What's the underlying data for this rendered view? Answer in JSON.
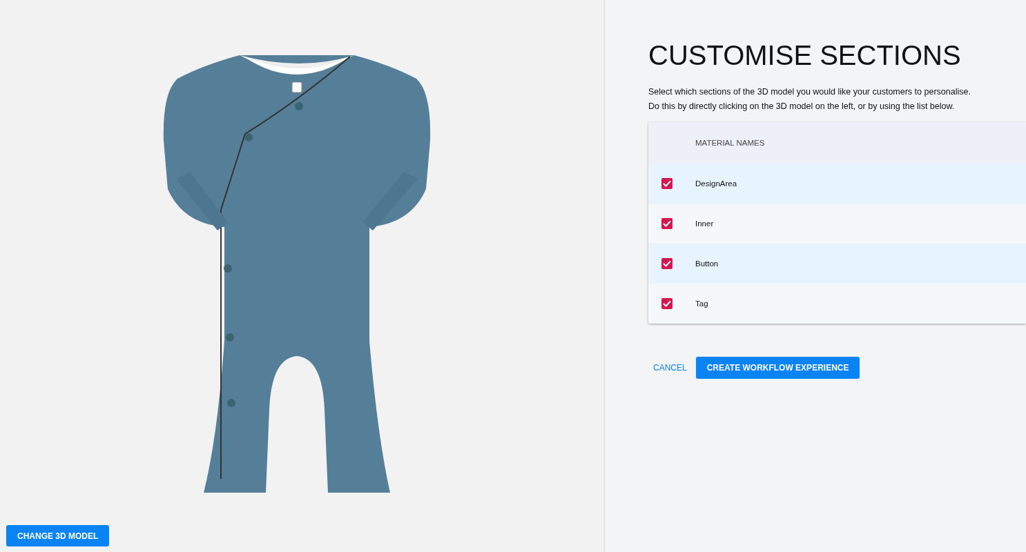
{
  "viewer": {
    "change_button": "CHANGE 3D MODEL"
  },
  "panel": {
    "title": "CUSTOMISE SECTIONS",
    "description": [
      "Select which sections of the 3D model you would like your customers to personalise.",
      "Do this by directly clicking on the 3D model on the left, or by using the list below."
    ],
    "table": {
      "columns": [
        "MATERIAL NAMES"
      ],
      "rows": [
        {
          "name": "DesignArea",
          "checked": true
        },
        {
          "name": "Inner",
          "checked": true
        },
        {
          "name": "Button",
          "checked": true
        },
        {
          "name": "Tag",
          "checked": true
        }
      ]
    },
    "cancel": "CANCEL",
    "create": "CREATE WORKFLOW EXPERIENCE"
  }
}
